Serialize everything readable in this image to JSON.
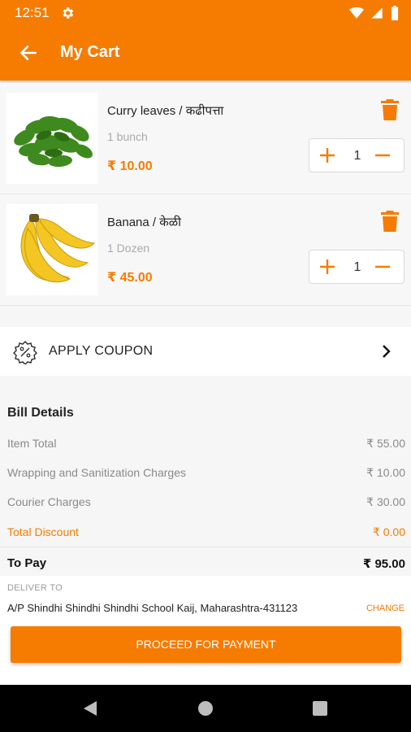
{
  "status_bar": {
    "time": "12:51",
    "icons": [
      "settings-icon",
      "wifi-icon",
      "signal-icon",
      "battery-icon"
    ]
  },
  "app_bar": {
    "title": "My Cart"
  },
  "cart_items": [
    {
      "name": "Curry leaves / कढीपत्ता",
      "unit": "1 bunch",
      "price": "₹ 10.00",
      "quantity": "1",
      "image": "curry-leaves-image"
    },
    {
      "name": "Banana / केळी",
      "unit": "1 Dozen",
      "price": "₹ 45.00",
      "quantity": "1",
      "image": "banana-image"
    }
  ],
  "coupon": {
    "label": "APPLY COUPON"
  },
  "bill": {
    "title": "Bill Details",
    "rows": [
      {
        "label": "Item Total",
        "amount": "₹ 55.00"
      },
      {
        "label": "Wrapping and Sanitization Charges",
        "amount": "₹ 10.00"
      },
      {
        "label": "Courier Charges",
        "amount": "₹ 30.00"
      },
      {
        "label": "Total Discount",
        "amount": "₹ 0.00"
      }
    ],
    "to_pay_label": "To Pay",
    "to_pay_amount": "₹ 95.00"
  },
  "delivery": {
    "label": "DELIVER TO",
    "address": "A/P Shindhi Shindhi Shindhi School Kaij, Maharashtra-431123",
    "change_label": "CHANGE"
  },
  "proceed_button": {
    "label": "PROCEED FOR PAYMENT"
  },
  "colors": {
    "accent": "#f57c00",
    "background": "#f6f6f6"
  }
}
